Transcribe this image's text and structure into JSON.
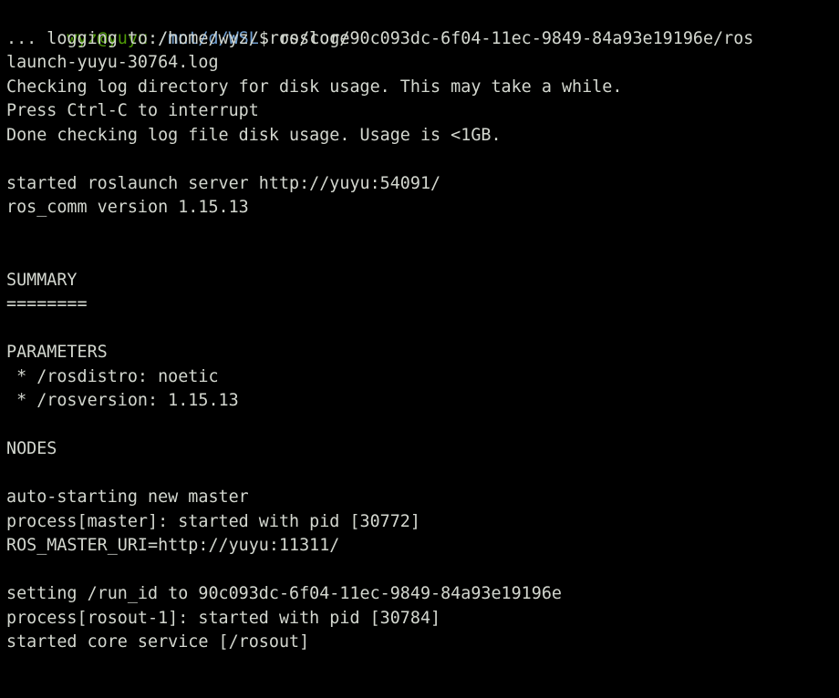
{
  "terminal": {
    "background_color": "#000000",
    "foreground_color": "#d3d7cf",
    "prompt_user_color": "#4e9a06",
    "prompt_path_color": "#729fcf",
    "shell": "bash",
    "command": "roscore"
  },
  "prompt": {
    "user_host": "wyz@yuyu",
    "separator": ":",
    "path": "/mnt/d/WSL",
    "sigil": "$",
    "command": " roscore"
  },
  "lines": [
    {
      "id": "log-path-1",
      "text": "... logging to /home/wyz/.ros/log/90c093dc-6f04-11ec-9849-84a93e19196e/ros"
    },
    {
      "id": "log-path-2",
      "text": "launch-yuyu-30764.log"
    },
    {
      "id": "checking-log",
      "text": "Checking log directory for disk usage. This may take a while."
    },
    {
      "id": "press-ctrl-c",
      "text": "Press Ctrl-C to interrupt"
    },
    {
      "id": "done-checking",
      "text": "Done checking log file disk usage. Usage is <1GB."
    },
    {
      "id": "blank-1",
      "text": ""
    },
    {
      "id": "roslaunch-srv",
      "text": "started roslaunch server http://yuyu:54091/"
    },
    {
      "id": "ros-comm-ver",
      "text": "ros_comm version 1.15.13"
    },
    {
      "id": "blank-2",
      "text": ""
    },
    {
      "id": "blank-3",
      "text": ""
    },
    {
      "id": "summary-head",
      "text": "SUMMARY"
    },
    {
      "id": "summary-rule",
      "text": "========"
    },
    {
      "id": "blank-4",
      "text": ""
    },
    {
      "id": "parameters-head",
      "text": "PARAMETERS"
    },
    {
      "id": "param-rosdistro",
      "text": " * /rosdistro: noetic"
    },
    {
      "id": "param-rosversion",
      "text": " * /rosversion: 1.15.13"
    },
    {
      "id": "blank-5",
      "text": ""
    },
    {
      "id": "nodes-head",
      "text": "NODES"
    },
    {
      "id": "blank-6",
      "text": ""
    },
    {
      "id": "auto-starting",
      "text": "auto-starting new master"
    },
    {
      "id": "process-master",
      "text": "process[master]: started with pid [30772]"
    },
    {
      "id": "ros-master-uri",
      "text": "ROS_MASTER_URI=http://yuyu:11311/"
    },
    {
      "id": "blank-7",
      "text": ""
    },
    {
      "id": "setting-run-id",
      "text": "setting /run_id to 90c093dc-6f04-11ec-9849-84a93e19196e"
    },
    {
      "id": "process-rosout",
      "text": "process[rosout-1]: started with pid [30784]"
    },
    {
      "id": "started-core",
      "text": "started core service [/rosout]"
    }
  ]
}
